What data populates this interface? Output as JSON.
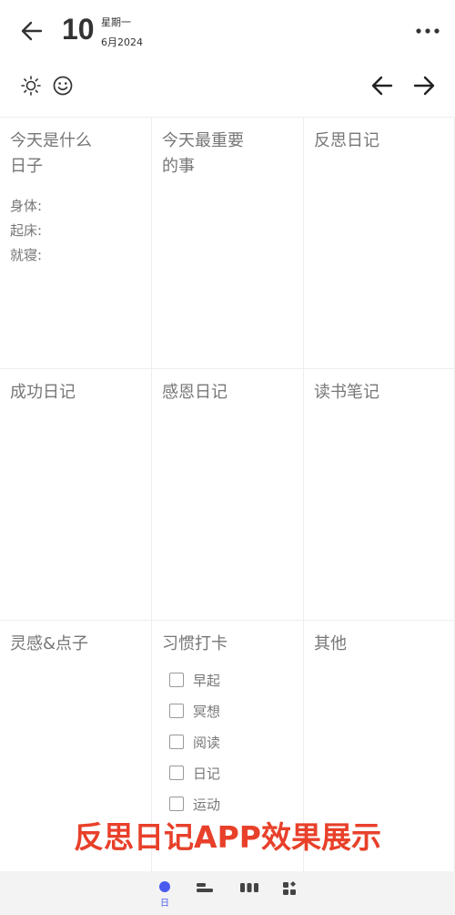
{
  "header": {
    "day": "10",
    "weekday": "星期一",
    "month_year": "6月2024"
  },
  "cells": [
    {
      "title": "今天是什么\n日子",
      "lines": [
        "身体:",
        "起床:",
        "就寝:"
      ]
    },
    {
      "title": "今天最重要\n的事",
      "lines": []
    },
    {
      "title": "反思日记",
      "lines": []
    },
    {
      "title": "成功日记",
      "lines": []
    },
    {
      "title": "感恩日记",
      "lines": []
    },
    {
      "title": "读书笔记",
      "lines": []
    },
    {
      "title": "灵感&点子",
      "lines": []
    },
    {
      "title": "习惯打卡",
      "habits": [
        "早起",
        "冥想",
        "阅读",
        "日记",
        "运动"
      ]
    },
    {
      "title": "其他",
      "lines": []
    }
  ],
  "watermark": "反思日记APP效果展示",
  "bottom_nav": {
    "active_label": "日",
    "accent_color": "#4a5cf0"
  },
  "icons": {
    "back": "back-arrow-icon",
    "more": "more-dots-icon",
    "weather": "sun-icon",
    "mood": "smiley-icon",
    "prev": "left-arrow-icon",
    "next": "right-arrow-icon"
  }
}
